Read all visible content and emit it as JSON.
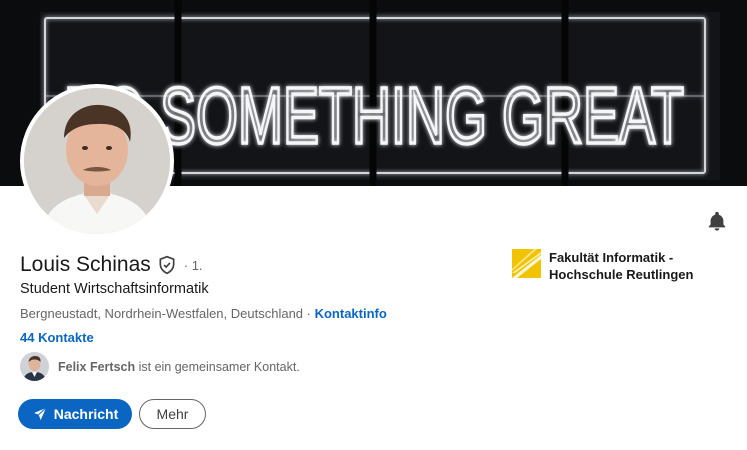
{
  "banner": {
    "sign_text": "DO SOMETHING GREAT"
  },
  "profile": {
    "name": "Louis Schinas",
    "degree": "· 1.",
    "headline": "Student Wirtschaftsinformatik",
    "location": "Bergneustadt, Nordrhein-Westfalen, Deutschland",
    "location_sep": " · ",
    "contact_info_label": "Kontaktinfo",
    "connections": "44 Kontakte",
    "mutual": {
      "name": "Felix Fertsch",
      "text": " ist ein gemeinsamer Kontakt."
    }
  },
  "actions": {
    "message_label": "Nachricht",
    "more_label": "Mehr"
  },
  "education": {
    "school_name": "Fakultät Informatik - Hochschule Reutlingen"
  },
  "icons": {
    "bell": "bell-icon",
    "verify": "shield-check-icon",
    "send": "paper-plane-icon"
  },
  "colors": {
    "link": "#0a66c2",
    "primary_button": "#0a66c2",
    "logo_yellow": "#f2c300"
  }
}
